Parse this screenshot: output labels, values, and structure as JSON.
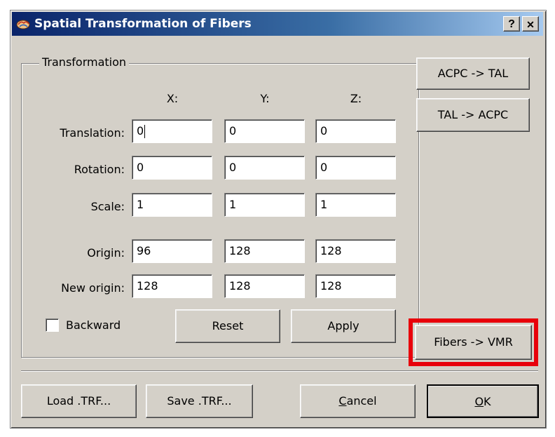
{
  "window": {
    "title": "Spatial Transformation of Fibers",
    "help_glyph": "?",
    "close_glyph": "✕"
  },
  "group": {
    "title": "Transformation",
    "headers": [
      "X:",
      "Y:",
      "Z:"
    ],
    "rows": [
      {
        "label": "Translation:",
        "values": [
          "0",
          "0",
          "0"
        ]
      },
      {
        "label": "Rotation:",
        "values": [
          "0",
          "0",
          "0"
        ]
      },
      {
        "label": "Scale:",
        "values": [
          "1",
          "1",
          "1"
        ]
      },
      {
        "label": "Origin:",
        "values": [
          "96",
          "128",
          "128"
        ]
      },
      {
        "label": "New origin:",
        "values": [
          "128",
          "128",
          "128"
        ]
      }
    ],
    "backward_label": "Backward",
    "backward_checked": false,
    "reset_label": "Reset",
    "apply_label": "Apply"
  },
  "side": {
    "acpc_tal": "ACPC -> TAL",
    "tal_acpc": "TAL -> ACPC",
    "fibers_vmr": "Fibers -> VMR"
  },
  "footer": {
    "load": "Load .TRF...",
    "save": "Save .TRF...",
    "cancel_mnemonic": "C",
    "cancel_rest": "ancel",
    "ok_mnemonic": "O",
    "ok_rest": "K"
  },
  "colors": {
    "highlight": "#e8000b",
    "titlebar_start": "#0a246a",
    "dialog_face": "#d4d0c8"
  },
  "icons": {
    "app": "brain-icon",
    "help": "help-icon",
    "close": "close-icon"
  }
}
